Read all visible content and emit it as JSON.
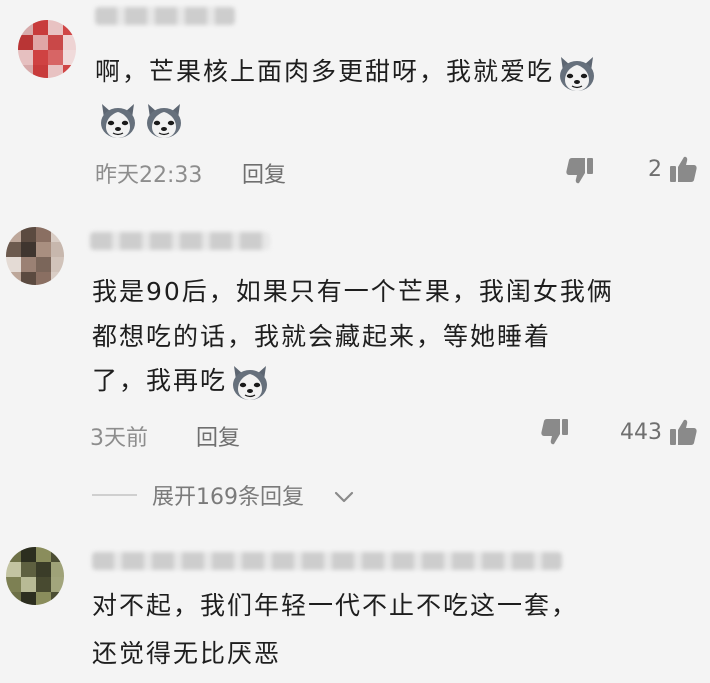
{
  "comments": [
    {
      "lines": [
        "啊，芒果核上面肉多更甜呀，我就爱吃"
      ],
      "time": "昨天22:33",
      "reply_label": "回复",
      "likes": "2",
      "avatar_colors": [
        "#d7aaaa",
        "#c83b3b",
        "#e8c2c2",
        "#d04545",
        "#b93535",
        "#e0a6a6",
        "#c94848",
        "#eed3d3",
        "#e6c0c0",
        "#cf4242",
        "#d76565",
        "#f0dada"
      ]
    },
    {
      "lines": [
        "我是90后，如果只有一个芒果，我闺女我俩",
        "都想吃的话，我就会藏起来，等她睡着",
        "了，我再吃"
      ],
      "time": "3天前",
      "reply_label": "回复",
      "likes": "443",
      "expand_label": "展开169条回复",
      "avatar_colors": [
        "#bda79a",
        "#5b4a40",
        "#8a6f62",
        "#d9cdc5",
        "#6c5a4e",
        "#3f352f",
        "#a98f80",
        "#c7b7ad",
        "#e4dbd5",
        "#9b8174",
        "#7b665a",
        "#d1c3ba"
      ]
    },
    {
      "lines": [
        "对不起，我们年轻一代不止不吃这一套，",
        "还觉得无比厌恶"
      ],
      "avatar_colors": [
        "#6d7047",
        "#2c2e1f",
        "#8a8d5c",
        "#4b4d33",
        "#c3c4a2",
        "#5e6040",
        "#3a3c28",
        "#9fa278",
        "#7d8053",
        "#b8ba95",
        "#484a30",
        "#a2a57c"
      ]
    }
  ],
  "icons": {
    "emoji": "husky-dog-emoji",
    "dislike": "thumbs-down-icon",
    "like": "thumbs-up-icon",
    "expand": "chevron-down-icon"
  }
}
